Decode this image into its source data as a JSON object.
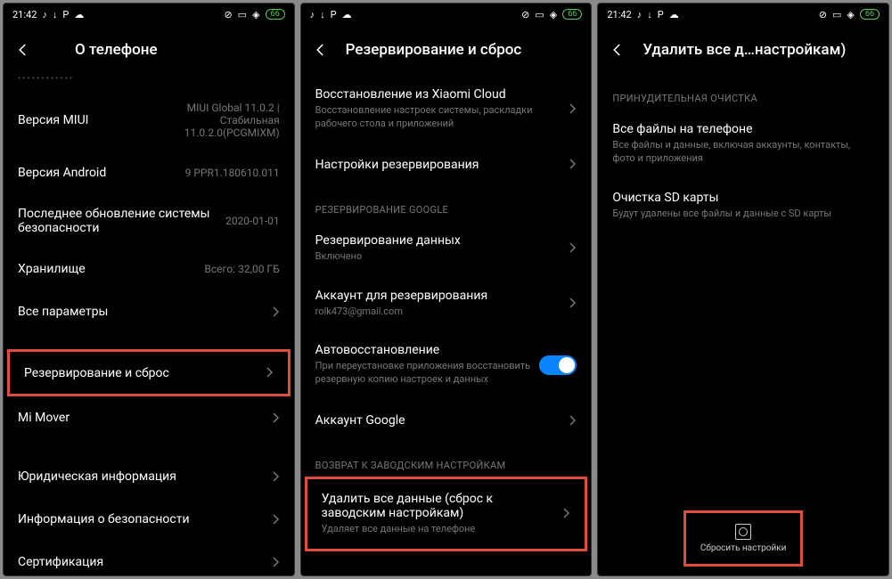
{
  "status": {
    "time": "21:42",
    "battery": "66",
    "icons_left": [
      "tiktok",
      "download",
      "p",
      "cloud"
    ],
    "icons_right": [
      "mute",
      "sim",
      "wifi"
    ]
  },
  "screen1": {
    "title": "О телефоне",
    "rows": {
      "miui": {
        "label": "Версия MIUI",
        "value": "MIUI Global 11.0.2 | Стабильная 11.0.2.0(PCGMIXM)"
      },
      "android": {
        "label": "Версия Android",
        "value": "9 PPR1.180610.011"
      },
      "security": {
        "label": "Последнее обновление системы безопасности",
        "value": "2020-01-01"
      },
      "storage": {
        "label": "Хранилище",
        "value": "Всего: 32,00 ГБ"
      },
      "allparams": {
        "label": "Все параметры"
      },
      "backup": {
        "label": "Резервирование и сброс"
      },
      "mimover": {
        "label": "Mi Mover"
      },
      "legal": {
        "label": "Юридическая информация"
      },
      "securityinfo": {
        "label": "Информация о безопасности"
      },
      "cert": {
        "label": "Сертификация"
      }
    }
  },
  "screen2": {
    "title": "Резервирование и сброс",
    "rows": {
      "xiaomi_cloud": {
        "label": "Восстановление из Xiaomi Cloud",
        "sub": "Восстановление настроек системы, раскладки рабочего стола и приложений"
      },
      "backup_settings": {
        "label": "Настройки резервирования"
      },
      "section_google": "РЕЗЕРВИРОВАНИЕ GOOGLE",
      "data_backup": {
        "label": "Резервирование данных",
        "sub": "Включено"
      },
      "backup_account": {
        "label": "Аккаунт для резервирования",
        "sub": "rolk473@gmail.com"
      },
      "auto_restore": {
        "label": "Автовосстановление",
        "sub": "При переустановке приложения восстановить резервную копию настроек и данных"
      },
      "google_account": {
        "label": "Аккаунт Google"
      },
      "section_factory": "ВОЗВРАТ К ЗАВОДСКИМ НАСТРОЙКАМ",
      "erase_all": {
        "label": "Удалить все данные (сброс к заводским настройкам)",
        "sub": "Удаляет все данные на телефоне"
      }
    }
  },
  "screen3": {
    "title": "Удалить все д…настройкам)",
    "section_force": "ПРИНУДИТЕЛЬНАЯ ОЧИСТКА",
    "rows": {
      "all_files": {
        "label": "Все файлы на телефоне",
        "sub": "Все файлы и данные, включая аккаунты, контакты, фото и приложения"
      },
      "sd": {
        "label": "Очистка SD карты",
        "sub": "Будут удалены все файлы и данные с SD карты"
      }
    },
    "reset_button": "Сбросить настройки"
  }
}
